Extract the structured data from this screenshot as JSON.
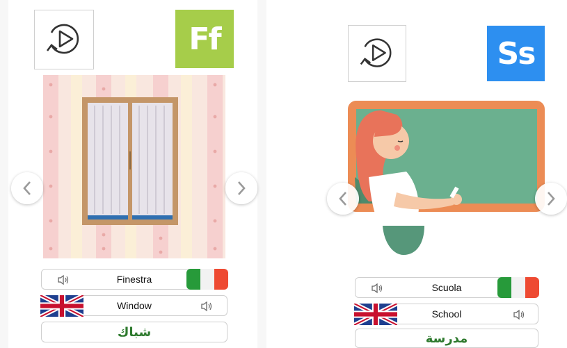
{
  "left_card": {
    "letter": "Ff",
    "letter_color": "#a6cd4a",
    "italian_word": "Finestra",
    "english_word": "Window",
    "arabic_word": "شباك"
  },
  "right_card": {
    "letter": "Ss",
    "letter_color": "#2d8ff0",
    "italian_word": "Scuola",
    "english_word": "School",
    "arabic_word": "مدرسة"
  },
  "icons": {
    "replay": "replay-play-icon",
    "prev": "chevron-left-icon",
    "next": "chevron-right-icon",
    "speaker": "speaker-icon",
    "flag_it": "italy-flag-icon",
    "flag_uk": "uk-flag-icon"
  }
}
